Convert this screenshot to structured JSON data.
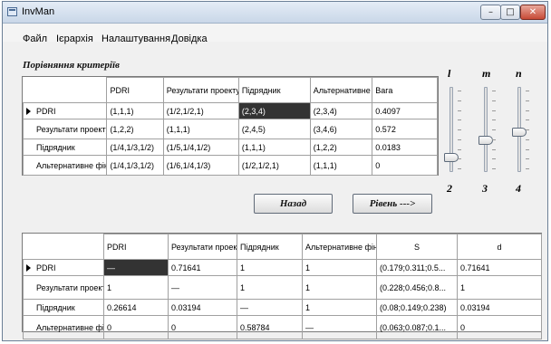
{
  "window": {
    "title": "InvMan",
    "controls": {
      "minimize": "–",
      "maximize": "□",
      "close": "✕"
    }
  },
  "menu": [
    "Файл",
    "Ієрархія",
    "Налаштування",
    "Довідка"
  ],
  "criteria_label": "Порівняння критеріїв",
  "grid1": {
    "columns": [
      "",
      "PDRI",
      "Результати проекту",
      "Підрядник",
      "Альтернативне фінансування",
      "Вага"
    ],
    "rows": [
      {
        "name": "PDRI",
        "cells": [
          "(1,1,1)",
          "(1/2,1/2,1)",
          "(2,3,4)",
          "(2,3,4)",
          "0.4097"
        ]
      },
      {
        "name": "Результати проекту",
        "cells": [
          "(1,2,2)",
          "(1,1,1)",
          "(2,4,5)",
          "(3,4,6)",
          "0.572"
        ]
      },
      {
        "name": "Підрядник",
        "cells": [
          "(1/4,1/3,1/2)",
          "(1/5,1/4,1/2)",
          "(1,1,1)",
          "(1,2,2)",
          "0.0183"
        ]
      },
      {
        "name": "Альтернативне фінансування",
        "cells": [
          "(1/4,1/3,1/2)",
          "(1/6,1/4,1/3)",
          "(1/2,1/2,1)",
          "(1,1,1)",
          "0"
        ]
      }
    ]
  },
  "buttons": {
    "back": "Назад",
    "next": "Рівень --->"
  },
  "sliders": [
    {
      "label": "l",
      "value": "2",
      "level": 0.83
    },
    {
      "label": "m",
      "value": "3",
      "level": 0.63
    },
    {
      "label": "n",
      "value": "4",
      "level": 0.53
    }
  ],
  "grid2": {
    "columns": [
      "",
      "PDRI",
      "Результати проекту",
      "Підрядник",
      "Альтернативне фінансування",
      "S",
      "d"
    ],
    "rows": [
      {
        "name": "PDRI",
        "cells": [
          "—",
          "0.71641",
          "1",
          "1",
          "(0.179;0.311;0.5...",
          "0.71641"
        ]
      },
      {
        "name": "Результати проекту",
        "cells": [
          "1",
          "—",
          "1",
          "1",
          "(0.228;0.456;0.8...",
          "1"
        ]
      },
      {
        "name": "Підрядник",
        "cells": [
          "0.26614",
          "0.03194",
          "—",
          "1",
          "(0.08;0.149;0.238)",
          "0.03194"
        ]
      },
      {
        "name": "Альтернативне фінансування",
        "cells": [
          "0",
          "0",
          "0.58784",
          "—",
          "(0.063;0.087;0.1...",
          "0"
        ]
      }
    ]
  }
}
